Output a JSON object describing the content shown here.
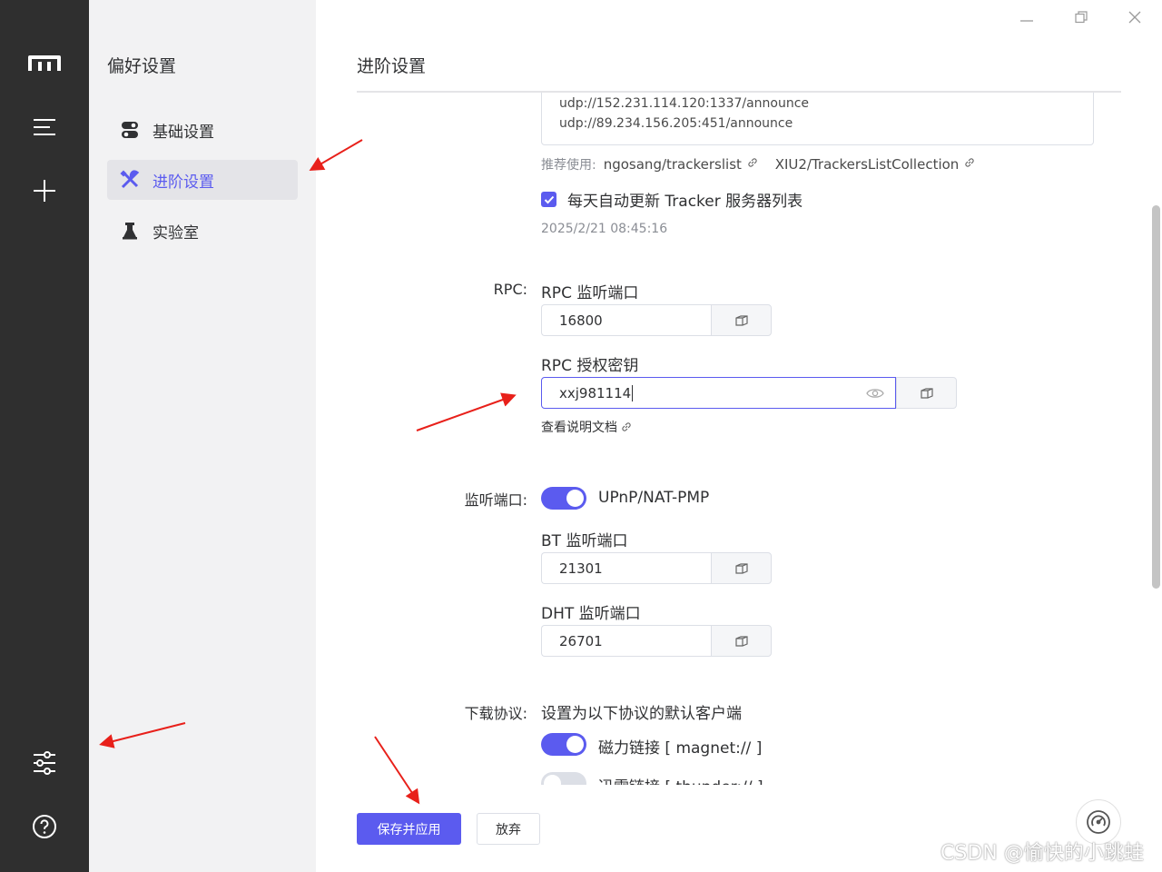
{
  "window": {
    "minimize_icon": "minimize-icon",
    "maximize_icon": "restore-icon",
    "close_icon": "close-icon"
  },
  "rail": {
    "logo_icon": "motrix-logo-icon",
    "items": [
      "task-list-icon",
      "add-task-icon"
    ],
    "bottom_items": [
      "preferences-icon",
      "help-icon"
    ]
  },
  "sidebar": {
    "title": "偏好设置",
    "items": [
      {
        "label": "基础设置",
        "icon": "toggle-icon"
      },
      {
        "label": "进阶设置",
        "icon": "tools-icon",
        "active": true
      },
      {
        "label": "实验室",
        "icon": "flask-icon"
      }
    ]
  },
  "main": {
    "title": "进阶设置",
    "trackers": {
      "lines": [
        "udp://152.231.114.120:1337/announce",
        "udp://89.234.156.205:451/announce"
      ],
      "recommend_label": "推荐使用:",
      "recommend_links": [
        "ngosang/trackerslist",
        "XIU2/TrackersListCollection"
      ],
      "auto_update_label": "每天自动更新 Tracker 服务器列表",
      "auto_update_checked": true,
      "last_update": "2025/2/21 08:45:16"
    },
    "rpc": {
      "row_label": "RPC:",
      "port_label": "RPC 监听端口",
      "port_value": "16800",
      "secret_label": "RPC 授权密钥",
      "secret_value": "xxj981114",
      "docs_link": "查看说明文档"
    },
    "listen": {
      "row_label": "监听端口:",
      "upnp_label": "UPnP/NAT-PMP",
      "upnp_on": true,
      "bt_label": "BT 监听端口",
      "bt_value": "21301",
      "dht_label": "DHT 监听端口",
      "dht_value": "26701"
    },
    "protocol": {
      "row_label": "下载协议:",
      "description": "设置为以下协议的默认客户端",
      "magnet_label": "磁力链接 [ magnet:// ]",
      "magnet_on": true,
      "thunder_label": "迅雷链接 [ thunder:// ]",
      "thunder_on": false
    },
    "footer": {
      "save_label": "保存并应用",
      "discard_label": "放弃"
    }
  },
  "watermark": "CSDN @愉快的小跳蛙",
  "colors": {
    "accent": "#5b5bef",
    "rail_bg": "#2f2f2f",
    "sidebar_bg": "#f2f2f3",
    "annotation_arrow": "#e8201a"
  }
}
